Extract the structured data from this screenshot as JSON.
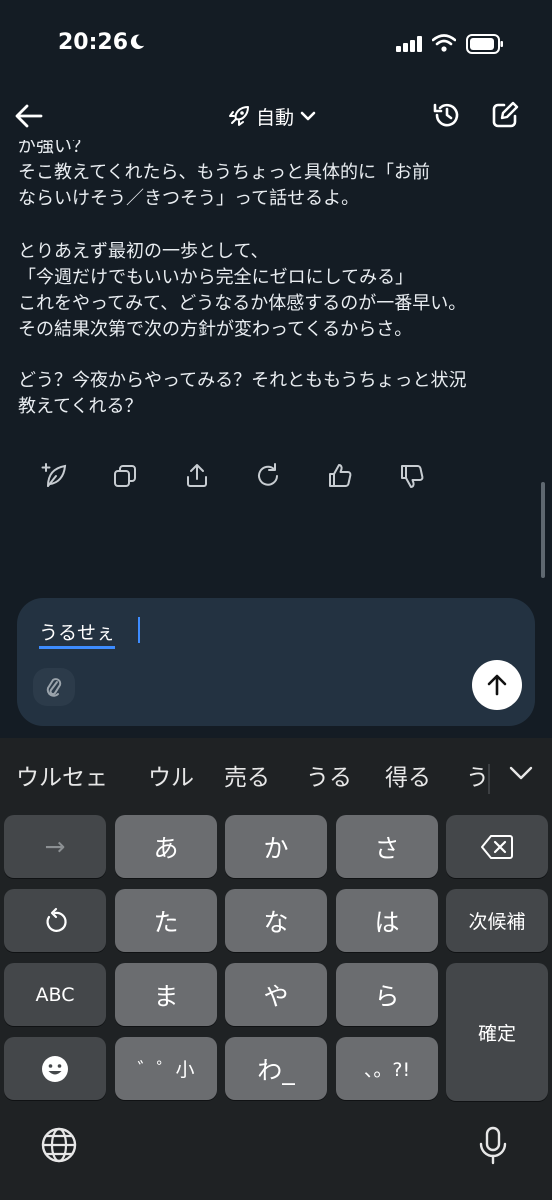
{
  "status": {
    "time": "20:26"
  },
  "header": {
    "mode_label": "自動"
  },
  "messages": {
    "para1": "が強い？\nそこ教えてくれたら、もうちょっと具体的に「お前\nならいけそう／きつそう」って話せるよ。",
    "para2": "とりあえず最初の一歩として、\n「今週だけでもいいから完全にゼロにしてみる」\nこれをやってみて、どうなるか体感するのが一番早い。\nその結果次第で次の方針が変わってくるからさ。",
    "para3": "どう？今夜からやってみる？それとももうちょっと状況\n教えてくれる？"
  },
  "message_actions": [
    "sparkle-leaf-icon",
    "copy-icon",
    "share-icon",
    "regenerate-icon",
    "thumbs-up-icon",
    "thumbs-down-icon"
  ],
  "composer": {
    "value": "うるせぇ"
  },
  "keyboard": {
    "candidates": [
      "ウルセェ",
      "ウル",
      "売る",
      "うる",
      "得る",
      "う"
    ],
    "keys": {
      "arrow": "→",
      "a": "あ",
      "ka": "か",
      "sa": "さ",
      "ta": "た",
      "na": "な",
      "ha": "は",
      "next_candidate": "次候補",
      "abc": "ABC",
      "ma": "ま",
      "ya": "や",
      "ra": "ら",
      "confirm": "確定",
      "dakuten": "゛゜小",
      "wa": "わ_",
      "punct": "、。?!"
    }
  },
  "colors": {
    "background": "#141c24",
    "composer": "#233241",
    "accent": "#3d8cff",
    "keyboard": "#1f2224"
  }
}
